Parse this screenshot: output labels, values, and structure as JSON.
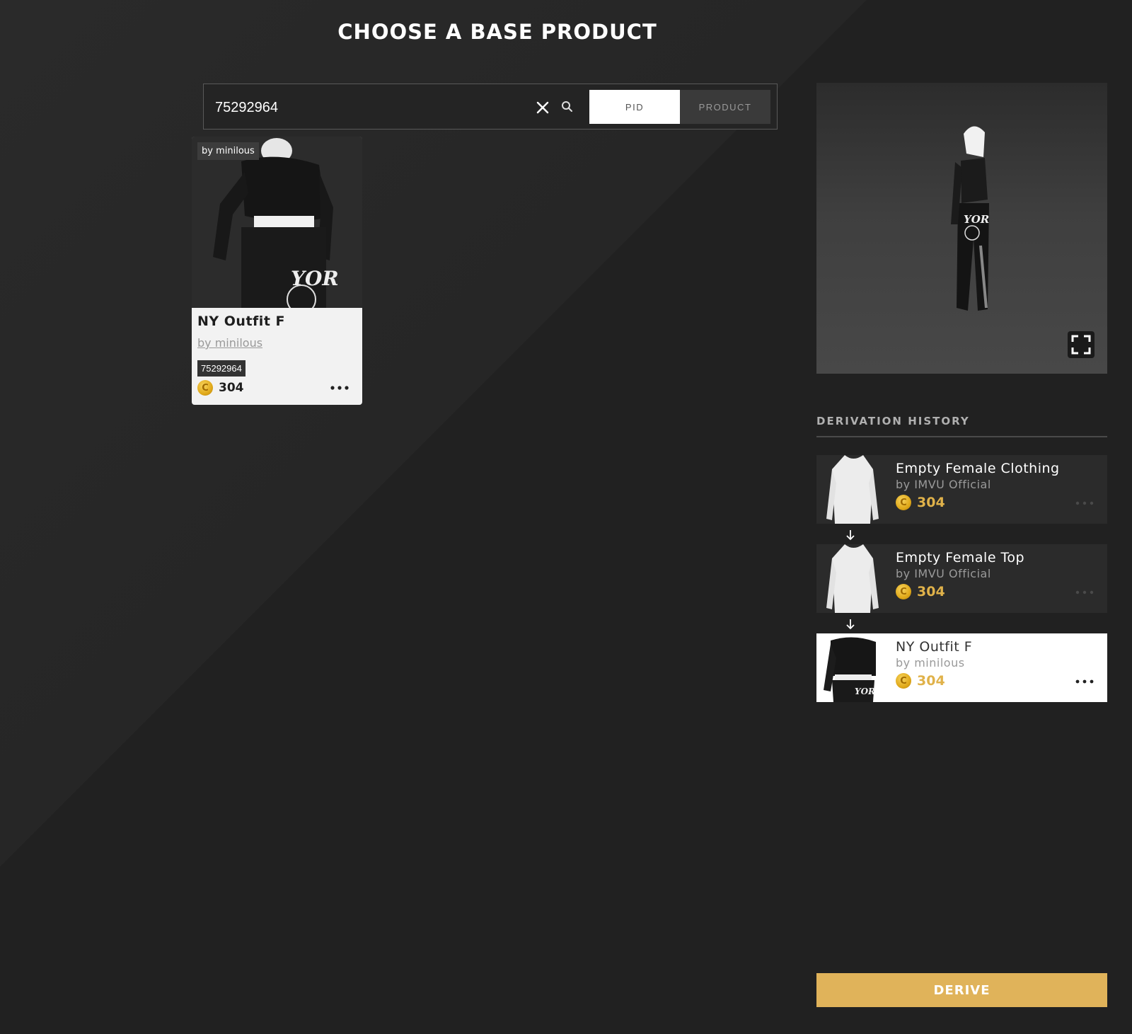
{
  "page_title": "CHOOSE A BASE PRODUCT",
  "search": {
    "value": "75292964",
    "toggles": [
      "PID",
      "PRODUCT"
    ],
    "selected_toggle": "PID"
  },
  "product_card": {
    "creator_badge": "by minilous",
    "title": "NY Outfit F",
    "creator": "by minilous",
    "pid": "75292964",
    "price": "304"
  },
  "derivation_history": {
    "heading": "DERIVATION HISTORY",
    "items": [
      {
        "name": "Empty Female Clothing",
        "creator": "by IMVU Official",
        "price": "304",
        "active": false
      },
      {
        "name": "Empty Female Top",
        "creator": "by IMVU Official",
        "price": "304",
        "active": false
      },
      {
        "name": "NY Outfit F",
        "creator": "by minilous",
        "price": "304",
        "active": true
      }
    ]
  },
  "derive_label": "DERIVE",
  "colors": {
    "accent_gold": "#e0b35a",
    "background": "#212121",
    "card_bg": "#f2f2f2"
  },
  "icons": {
    "clear": "close-icon",
    "search": "search-icon",
    "expand": "expand-icon",
    "more": "more-icon",
    "coin": "credits-coin-icon",
    "arrow": "arrow-down-icon"
  }
}
